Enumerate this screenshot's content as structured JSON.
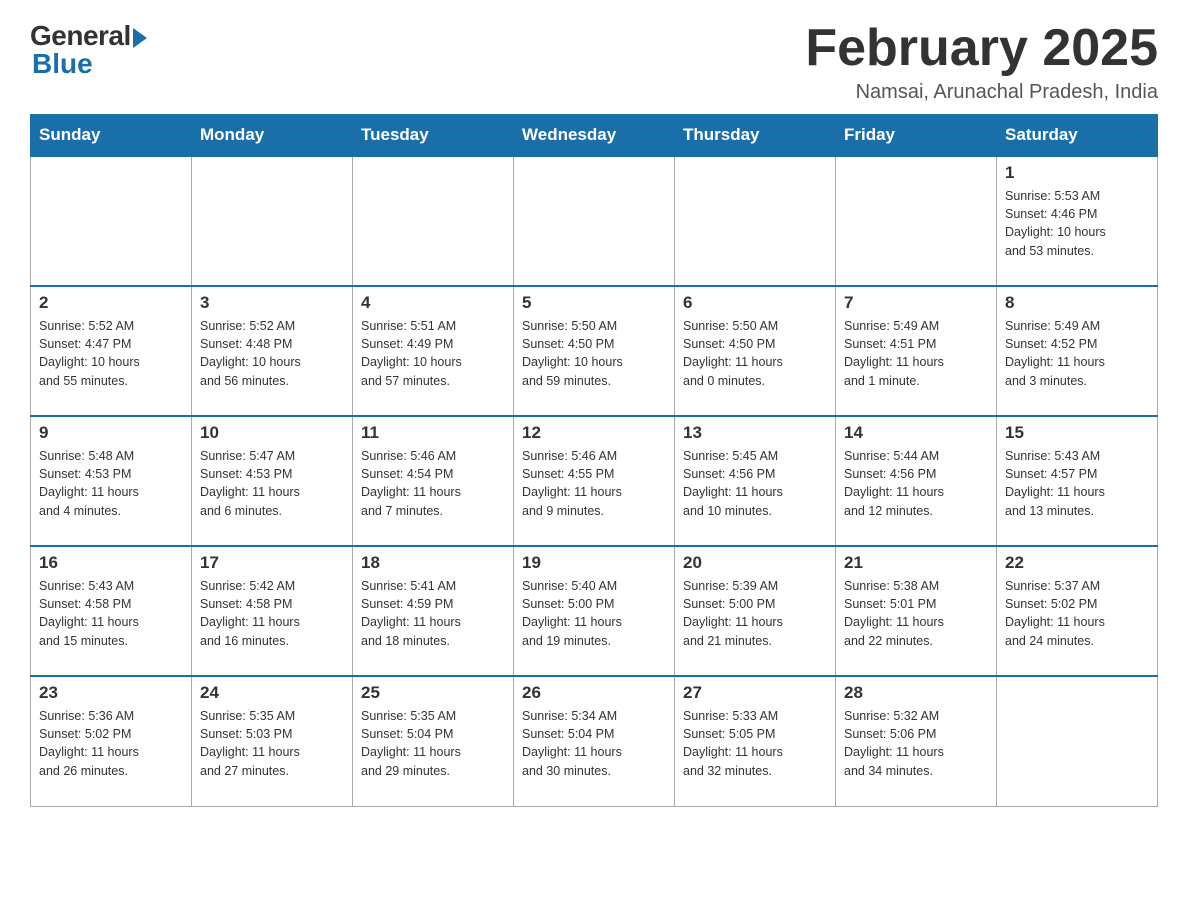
{
  "header": {
    "logo_general": "General",
    "logo_blue": "Blue",
    "month_title": "February 2025",
    "location": "Namsai, Arunachal Pradesh, India"
  },
  "days_of_week": [
    "Sunday",
    "Monday",
    "Tuesday",
    "Wednesday",
    "Thursday",
    "Friday",
    "Saturday"
  ],
  "weeks": [
    [
      {
        "day": "",
        "info": ""
      },
      {
        "day": "",
        "info": ""
      },
      {
        "day": "",
        "info": ""
      },
      {
        "day": "",
        "info": ""
      },
      {
        "day": "",
        "info": ""
      },
      {
        "day": "",
        "info": ""
      },
      {
        "day": "1",
        "info": "Sunrise: 5:53 AM\nSunset: 4:46 PM\nDaylight: 10 hours\nand 53 minutes."
      }
    ],
    [
      {
        "day": "2",
        "info": "Sunrise: 5:52 AM\nSunset: 4:47 PM\nDaylight: 10 hours\nand 55 minutes."
      },
      {
        "day": "3",
        "info": "Sunrise: 5:52 AM\nSunset: 4:48 PM\nDaylight: 10 hours\nand 56 minutes."
      },
      {
        "day": "4",
        "info": "Sunrise: 5:51 AM\nSunset: 4:49 PM\nDaylight: 10 hours\nand 57 minutes."
      },
      {
        "day": "5",
        "info": "Sunrise: 5:50 AM\nSunset: 4:50 PM\nDaylight: 10 hours\nand 59 minutes."
      },
      {
        "day": "6",
        "info": "Sunrise: 5:50 AM\nSunset: 4:50 PM\nDaylight: 11 hours\nand 0 minutes."
      },
      {
        "day": "7",
        "info": "Sunrise: 5:49 AM\nSunset: 4:51 PM\nDaylight: 11 hours\nand 1 minute."
      },
      {
        "day": "8",
        "info": "Sunrise: 5:49 AM\nSunset: 4:52 PM\nDaylight: 11 hours\nand 3 minutes."
      }
    ],
    [
      {
        "day": "9",
        "info": "Sunrise: 5:48 AM\nSunset: 4:53 PM\nDaylight: 11 hours\nand 4 minutes."
      },
      {
        "day": "10",
        "info": "Sunrise: 5:47 AM\nSunset: 4:53 PM\nDaylight: 11 hours\nand 6 minutes."
      },
      {
        "day": "11",
        "info": "Sunrise: 5:46 AM\nSunset: 4:54 PM\nDaylight: 11 hours\nand 7 minutes."
      },
      {
        "day": "12",
        "info": "Sunrise: 5:46 AM\nSunset: 4:55 PM\nDaylight: 11 hours\nand 9 minutes."
      },
      {
        "day": "13",
        "info": "Sunrise: 5:45 AM\nSunset: 4:56 PM\nDaylight: 11 hours\nand 10 minutes."
      },
      {
        "day": "14",
        "info": "Sunrise: 5:44 AM\nSunset: 4:56 PM\nDaylight: 11 hours\nand 12 minutes."
      },
      {
        "day": "15",
        "info": "Sunrise: 5:43 AM\nSunset: 4:57 PM\nDaylight: 11 hours\nand 13 minutes."
      }
    ],
    [
      {
        "day": "16",
        "info": "Sunrise: 5:43 AM\nSunset: 4:58 PM\nDaylight: 11 hours\nand 15 minutes."
      },
      {
        "day": "17",
        "info": "Sunrise: 5:42 AM\nSunset: 4:58 PM\nDaylight: 11 hours\nand 16 minutes."
      },
      {
        "day": "18",
        "info": "Sunrise: 5:41 AM\nSunset: 4:59 PM\nDaylight: 11 hours\nand 18 minutes."
      },
      {
        "day": "19",
        "info": "Sunrise: 5:40 AM\nSunset: 5:00 PM\nDaylight: 11 hours\nand 19 minutes."
      },
      {
        "day": "20",
        "info": "Sunrise: 5:39 AM\nSunset: 5:00 PM\nDaylight: 11 hours\nand 21 minutes."
      },
      {
        "day": "21",
        "info": "Sunrise: 5:38 AM\nSunset: 5:01 PM\nDaylight: 11 hours\nand 22 minutes."
      },
      {
        "day": "22",
        "info": "Sunrise: 5:37 AM\nSunset: 5:02 PM\nDaylight: 11 hours\nand 24 minutes."
      }
    ],
    [
      {
        "day": "23",
        "info": "Sunrise: 5:36 AM\nSunset: 5:02 PM\nDaylight: 11 hours\nand 26 minutes."
      },
      {
        "day": "24",
        "info": "Sunrise: 5:35 AM\nSunset: 5:03 PM\nDaylight: 11 hours\nand 27 minutes."
      },
      {
        "day": "25",
        "info": "Sunrise: 5:35 AM\nSunset: 5:04 PM\nDaylight: 11 hours\nand 29 minutes."
      },
      {
        "day": "26",
        "info": "Sunrise: 5:34 AM\nSunset: 5:04 PM\nDaylight: 11 hours\nand 30 minutes."
      },
      {
        "day": "27",
        "info": "Sunrise: 5:33 AM\nSunset: 5:05 PM\nDaylight: 11 hours\nand 32 minutes."
      },
      {
        "day": "28",
        "info": "Sunrise: 5:32 AM\nSunset: 5:06 PM\nDaylight: 11 hours\nand 34 minutes."
      },
      {
        "day": "",
        "info": ""
      }
    ]
  ]
}
